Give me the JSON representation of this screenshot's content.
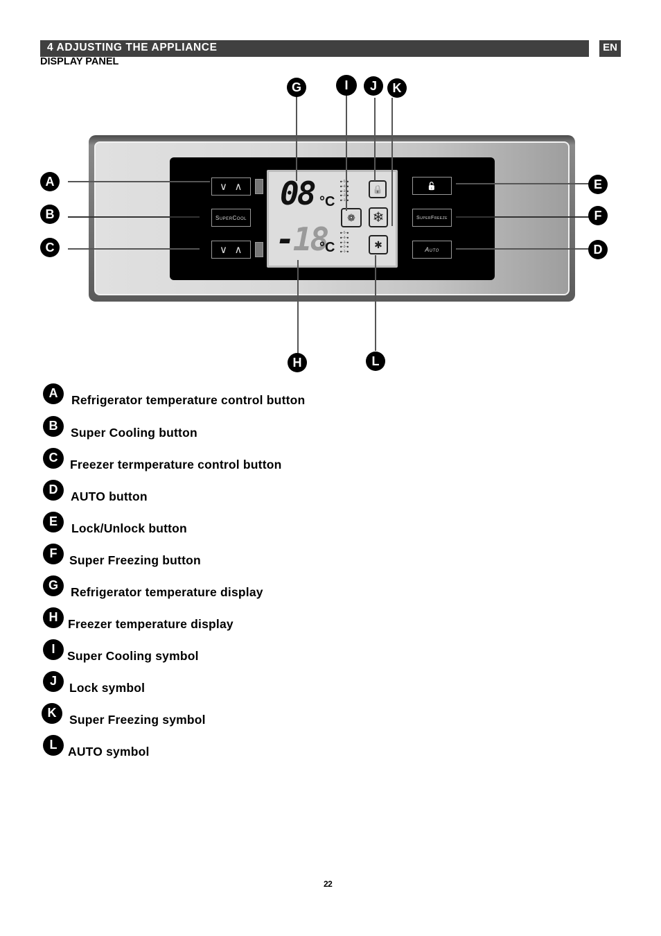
{
  "header": {
    "section_title": "4 ADJUSTING THE APPLIANCE",
    "language": "EN",
    "subtitle": "DISPLAY PANEL"
  },
  "panel": {
    "buttons": {
      "fridge_down": "∨",
      "fridge_up": "∧",
      "supercool": "SuperCool",
      "freezer_down": "∨",
      "freezer_up": "∧",
      "lock": "🔓",
      "superfreeze": "SuperFreeze",
      "auto": "Auto"
    },
    "lcd": {
      "fridge_temp": {
        "prefix": "",
        "digits": "08",
        "unit": "°C"
      },
      "freezer_temp": {
        "prefix": "-",
        "digits": "18",
        "unit": "°C"
      },
      "level_scale": [
        "5",
        "4",
        "3",
        "2",
        "1"
      ],
      "symbols": {
        "lock": "🔒",
        "supercool": "❁",
        "superfreeze": "❄",
        "auto": "✱"
      }
    },
    "callouts": {
      "A": "A",
      "B": "B",
      "C": "C",
      "D": "D",
      "E": "E",
      "F": "F",
      "G": "G",
      "H": "H",
      "I": "I",
      "J": "J",
      "K": "K",
      "L": "L"
    }
  },
  "legend": [
    {
      "letter": "A",
      "text": "Refrigerator temperature control button"
    },
    {
      "letter": "B",
      "text": "Super Cooling button"
    },
    {
      "letter": "C",
      "text": "Freezer termperature control button"
    },
    {
      "letter": "D",
      "text": "AUTO button"
    },
    {
      "letter": "E",
      "text": "Lock/Unlock button"
    },
    {
      "letter": "F",
      "text": "Super Freezing button"
    },
    {
      "letter": "G",
      "text": "Refrigerator temperature display"
    },
    {
      "letter": "H",
      "text": "Freezer temperature display"
    },
    {
      "letter": "I",
      "text": "Super Cooling symbol"
    },
    {
      "letter": "J",
      "text": "Lock symbol"
    },
    {
      "letter": "K",
      "text": "Super Freezing symbol"
    },
    {
      "letter": "L",
      "text": "AUTO symbol"
    }
  ],
  "footer": {
    "page_number": "22"
  }
}
